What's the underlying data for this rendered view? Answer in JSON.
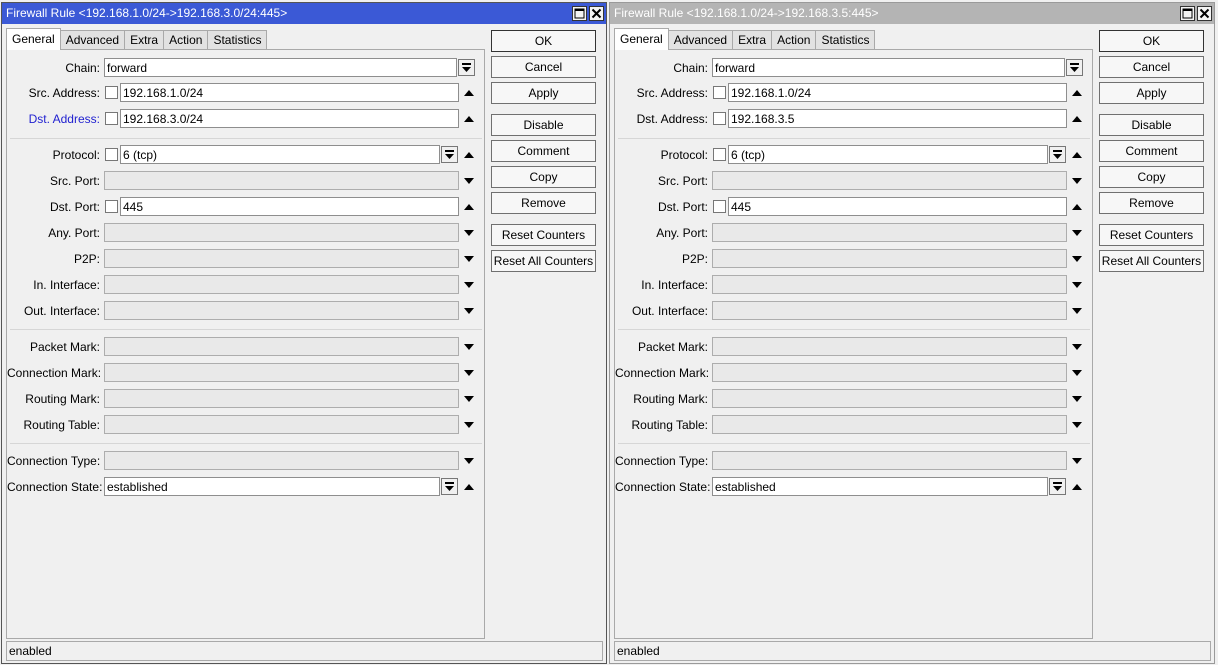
{
  "tabs": [
    "General",
    "Advanced",
    "Extra",
    "Action",
    "Statistics"
  ],
  "buttons": {
    "ok": "OK",
    "cancel": "Cancel",
    "apply": "Apply",
    "disable": "Disable",
    "comment": "Comment",
    "copy": "Copy",
    "remove": "Remove",
    "reset_counters": "Reset Counters",
    "reset_all_counters": "Reset All Counters"
  },
  "labels": {
    "chain": "Chain:",
    "src_address": "Src. Address:",
    "dst_address": "Dst. Address:",
    "protocol": "Protocol:",
    "src_port": "Src. Port:",
    "dst_port": "Dst. Port:",
    "any_port": "Any. Port:",
    "p2p": "P2P:",
    "in_interface": "In. Interface:",
    "out_interface": "Out. Interface:",
    "packet_mark": "Packet Mark:",
    "connection_mark": "Connection Mark:",
    "routing_mark": "Routing Mark:",
    "routing_table": "Routing Table:",
    "connection_type": "Connection Type:",
    "connection_state": "Connection State:"
  },
  "windows": [
    {
      "title": "Firewall Rule <192.168.1.0/24->192.168.3.0/24:445>",
      "active": true,
      "values": {
        "chain": "forward",
        "src_address": "192.168.1.0/24",
        "dst_address": "192.168.3.0/24",
        "protocol": "6 (tcp)",
        "dst_port": "445",
        "connection_state": "established"
      },
      "status": "enabled"
    },
    {
      "title": "Firewall Rule <192.168.1.0/24->192.168.3.5:445>",
      "active": false,
      "values": {
        "chain": "forward",
        "src_address": "192.168.1.0/24",
        "dst_address": "192.168.3.5",
        "protocol": "6 (tcp)",
        "dst_port": "445",
        "connection_state": "established"
      },
      "status": "enabled"
    }
  ],
  "icons": {
    "maximize": "maximize-icon",
    "close": "close-icon",
    "dropdown": "dropdown-arrow-icon",
    "arrow_up": "arrow-up-icon",
    "arrow_down": "arrow-down-icon"
  },
  "colors": {
    "active_title": "#3b59d6",
    "inactive_title": "#b4b4b4",
    "highlight_label": "#1f1fd0"
  }
}
